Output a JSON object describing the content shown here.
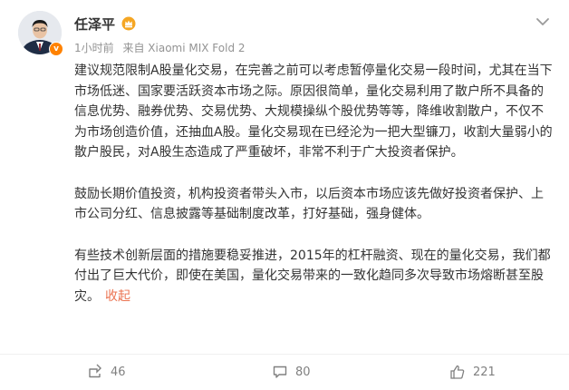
{
  "post": {
    "author": "任泽平",
    "time": "1小时前",
    "source": "来自 Xiaomi MIX Fold 2",
    "badge": "v",
    "paragraphs": [
      "建议规范限制A股量化交易，在完善之前可以考虑暂停量化交易一段时间，尤其在当下市场低迷、国家要活跃资本市场之际。原因很简单，量化交易利用了散户所不具备的信息优势、融券优势、交易优势、大规模操纵个股优势等等，降维收割散户，不仅不为市场创造价值，还抽血A股。量化交易现在已经沦为一把大型镰刀，收割大量弱小的散户股民，对A股生态造成了严重破坏，非常不利于广大投资者保护。",
      "鼓励长期价值投资，机构投资者带头入市，以后资本市场应该先做好投资者保护、上市公司分红、信息披露等基础制度改革，打好基础，强身健体。",
      "有些技术创新层面的措施要稳妥推进，2015年的杠杆融资、现在的量化交易，我们都付出了巨大代价，即使在美国，量化交易带来的一致化趋同多次导致市场熔断甚至股灾。"
    ],
    "collapse_label": "收起"
  },
  "actions": {
    "repost_count": "46",
    "comment_count": "80",
    "like_count": "221"
  },
  "icons": {
    "repost": "repost-icon",
    "comment": "comment-icon",
    "like": "thumbs-up-icon",
    "more": "chevron-down-icon",
    "member": "crown-icon"
  },
  "colors": {
    "accent": "#eb7350",
    "verified": "#ff8200",
    "member_gold": "#f5a623"
  }
}
